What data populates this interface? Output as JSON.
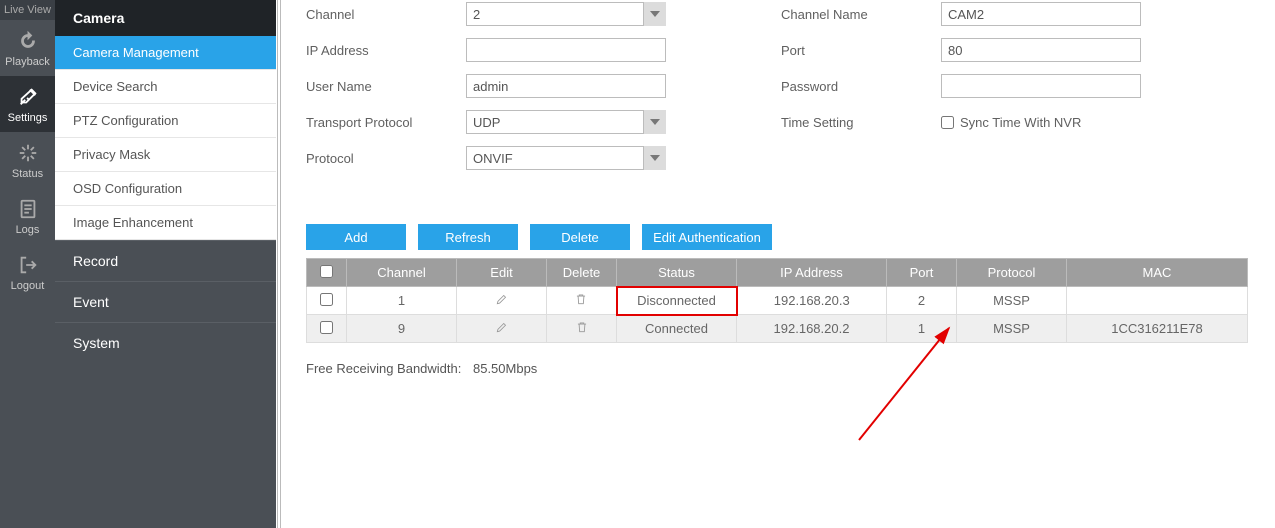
{
  "iconbar": {
    "liveview": "Live View",
    "playback": "Playback",
    "settings": "Settings",
    "status": "Status",
    "logs": "Logs",
    "logout": "Logout"
  },
  "menu": {
    "camera": "Camera",
    "camera_management": "Camera Management",
    "device_search": "Device Search",
    "ptz_configuration": "PTZ Configuration",
    "privacy_mask": "Privacy Mask",
    "osd_configuration": "OSD Configuration",
    "image_enhancement": "Image Enhancement",
    "record": "Record",
    "event": "Event",
    "system": "System"
  },
  "form": {
    "channel_label": "Channel",
    "channel_value": "2",
    "channel_name_label": "Channel Name",
    "channel_name_value": "CAM2",
    "ip_label": "IP Address",
    "ip_value": "",
    "port_label": "Port",
    "port_value": "80",
    "user_label": "User Name",
    "user_value": "admin",
    "password_label": "Password",
    "password_value": "",
    "transport_label": "Transport Protocol",
    "transport_value": "UDP",
    "time_label": "Time Setting",
    "time_checkbox": "Sync Time With NVR",
    "protocol_label": "Protocol",
    "protocol_value": "ONVIF"
  },
  "buttons": {
    "add": "Add",
    "refresh": "Refresh",
    "delete": "Delete",
    "edit_auth": "Edit Authentication"
  },
  "table": {
    "headers": {
      "channel": "Channel",
      "edit": "Edit",
      "delete": "Delete",
      "status": "Status",
      "ip": "IP Address",
      "port": "Port",
      "protocol": "Protocol",
      "mac": "MAC"
    },
    "rows": [
      {
        "channel": "1",
        "status": "Disconnected",
        "ip": "192.168.20.3",
        "port": "2",
        "protocol": "MSSP",
        "mac": ""
      },
      {
        "channel": "9",
        "status": "Connected",
        "ip": "192.168.20.2",
        "port": "1",
        "protocol": "MSSP",
        "mac": "1CC316211E78"
      }
    ]
  },
  "bandwidth": {
    "label": "Free Receiving Bandwidth:",
    "value": "85.50Mbps"
  }
}
